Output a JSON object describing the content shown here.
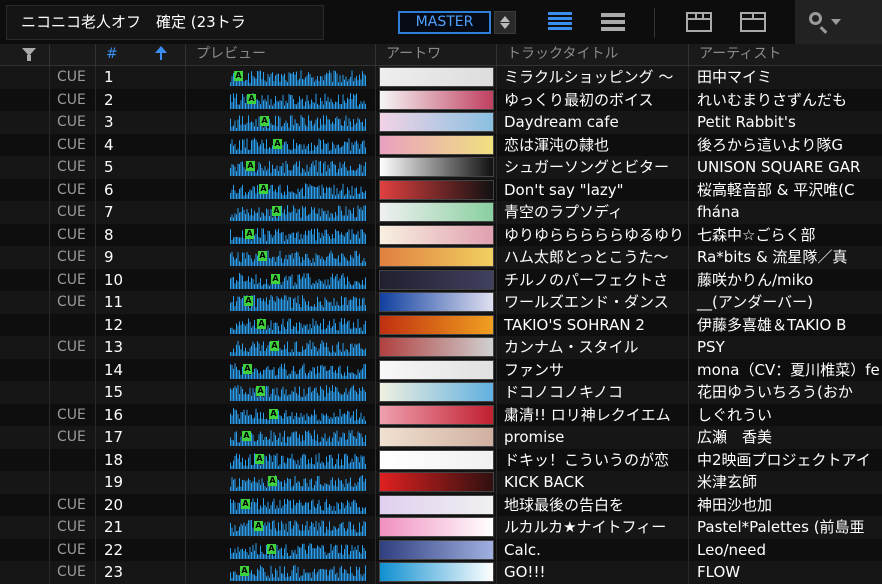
{
  "playlist": {
    "title": "ニコニコ老人オフ　確定 (23トラ"
  },
  "toolbar": {
    "master_label": "MASTER"
  },
  "columns": {
    "number": "#",
    "preview": "プレビュー",
    "artwork": "アートワ",
    "track_title": "トラックタイトル",
    "artist": "アーティスト"
  },
  "colors": {
    "accent": "#3a8ef0",
    "waveform": "#2a9ff0",
    "cue_a": "#3fd23a"
  },
  "tracks": [
    {
      "cue": "CUE",
      "num": "1",
      "title": "ミラクルショッピング 〜",
      "artist": "田中マイミ",
      "art": [
        "#eeeeee",
        "#dddddd"
      ]
    },
    {
      "cue": "CUE",
      "num": "2",
      "title": "ゆっくり最初のボイス",
      "artist": "れいむまりさずんだも",
      "art": [
        "#f5f5f5",
        "#c04060"
      ]
    },
    {
      "cue": "CUE",
      "num": "3",
      "title": "Daydream cafe",
      "artist": "Petit Rabbit's",
      "art": [
        "#f3d3e6",
        "#8ac0e0"
      ]
    },
    {
      "cue": "CUE",
      "num": "4",
      "title": "恋は渾沌の隷也",
      "artist": "後ろから這いより隊G",
      "art": [
        "#e9a0c0",
        "#f0e080"
      ]
    },
    {
      "cue": "CUE",
      "num": "5",
      "title": "シュガーソングとビター",
      "artist": "UNISON SQUARE GAR",
      "art": [
        "#ffffff",
        "#111111"
      ]
    },
    {
      "cue": "CUE",
      "num": "6",
      "title": "Don't say \"lazy\"",
      "artist": "桜高軽音部 & 平沢唯(C",
      "art": [
        "#e04040",
        "#111111"
      ]
    },
    {
      "cue": "CUE",
      "num": "7",
      "title": "青空のラプソディ",
      "artist": "fhána",
      "art": [
        "#f0f0f0",
        "#88d0a0"
      ]
    },
    {
      "cue": "CUE",
      "num": "8",
      "title": "ゆりゆらららららゆるゆり",
      "artist": "七森中☆ごらく部",
      "art": [
        "#f8f0e0",
        "#e0a0b0"
      ]
    },
    {
      "cue": "CUE",
      "num": "9",
      "title": "ハム太郎とっとこうた〜",
      "artist": "Ra*bits & 流星隊／真",
      "art": [
        "#e08040",
        "#f0d060"
      ]
    },
    {
      "cue": "CUE",
      "num": "10",
      "title": "チルノのパーフェクトさ",
      "artist": "藤咲かりん/miko",
      "art": [
        "#202030",
        "#404060"
      ]
    },
    {
      "cue": "CUE",
      "num": "11",
      "title": "ワールズエンド・ダンス",
      "artist": "__(アンダーバー)",
      "art": [
        "#1040a0",
        "#e0e0f0"
      ]
    },
    {
      "cue": "",
      "num": "12",
      "title": "TAKIO'S SOHRAN 2",
      "artist": "伊藤多喜雄＆TAKIO B",
      "art": [
        "#c03010",
        "#f0a020"
      ]
    },
    {
      "cue": "CUE",
      "num": "13",
      "title": "カンナム・スタイル",
      "artist": "PSY",
      "art": [
        "#b04040",
        "#d0d0d0"
      ]
    },
    {
      "cue": "",
      "num": "14",
      "title": "ファンサ",
      "artist": "mona（CV：夏川椎菜）fe",
      "art": [
        "#f8f8f8",
        "#e0e0e0"
      ]
    },
    {
      "cue": "",
      "num": "15",
      "title": "ドコノコノキノコ",
      "artist": "花田ゆういちろう(おか",
      "art": [
        "#f0f0e0",
        "#60b0e0"
      ]
    },
    {
      "cue": "CUE",
      "num": "16",
      "title": "粛清!! ロリ神レクイエム",
      "artist": "しぐれうい",
      "art": [
        "#f0a0b0",
        "#c02030"
      ]
    },
    {
      "cue": "CUE",
      "num": "17",
      "title": "promise",
      "artist": "広瀬　香美",
      "art": [
        "#f0e0d0",
        "#d0b0a0"
      ]
    },
    {
      "cue": "",
      "num": "18",
      "title": "ドキッ！こういうのが恋",
      "artist": "中2映画プロジェクトアイ",
      "art": [
        "#ffffff",
        "#f0f0f0"
      ]
    },
    {
      "cue": "",
      "num": "19",
      "title": "KICK BACK",
      "artist": "米津玄師",
      "art": [
        "#e02020",
        "#301010"
      ]
    },
    {
      "cue": "CUE",
      "num": "20",
      "title": "地球最後の告白を",
      "artist": "神田沙也加",
      "art": [
        "#e0d0f0",
        "#f0f0f0"
      ]
    },
    {
      "cue": "CUE",
      "num": "21",
      "title": "ルカルカ★ナイトフィー",
      "artist": "Pastel*Palettes (前島亜",
      "art": [
        "#f090c0",
        "#ffffff"
      ]
    },
    {
      "cue": "CUE",
      "num": "22",
      "title": "Calc.",
      "artist": "Leo/need",
      "art": [
        "#304080",
        "#a0b0e0"
      ]
    },
    {
      "cue": "CUE",
      "num": "23",
      "title": "GO!!!",
      "artist": "FLOW",
      "art": [
        "#1090d0",
        "#ffffff"
      ]
    }
  ]
}
